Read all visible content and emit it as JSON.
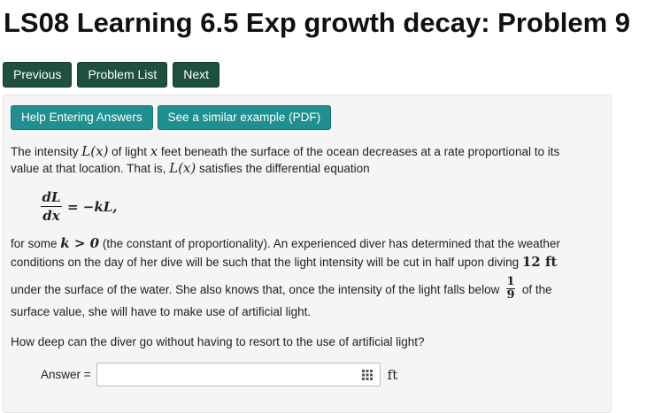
{
  "page": {
    "title": "LS08 Learning 6.5 Exp growth decay: Problem 9"
  },
  "nav": {
    "previous_label": "Previous",
    "problem_list_label": "Problem List",
    "next_label": "Next"
  },
  "help": {
    "help_entering_label": "Help Entering Answers",
    "similar_example_label": "See a similar example (PDF)"
  },
  "problem": {
    "p1_a": "The intensity ",
    "p1_Lx": "L(x)",
    "p1_b": " of light ",
    "p1_x": "x",
    "p1_c": " feet beneath the surface of the ocean decreases at a rate proportional to its",
    "p2_a": "value at that location. That is, ",
    "p2_Lx": "L(x)",
    "p2_b": " satisfies the differential equation",
    "eq_num": "dL",
    "eq_den": "dx",
    "eq_rhs": "= −kL,",
    "p3_a": "for some ",
    "p3_k": "k > 0",
    "p3_b": " (the constant of proportionality). An experienced diver has determined that the weather",
    "p4_a": "conditions on the day of her dive will be such that the light intensity will be cut in half upon diving ",
    "p4_depth": "12 ft",
    "p5_a": "under the surface of the water. She also knows that, once the intensity of the light falls below ",
    "p5_frac_num": "1",
    "p5_frac_den": "9",
    "p5_b": " of the",
    "p6": "surface value, she will have to make use of artificial light.",
    "question": "How deep can the diver go without having to resort to the use of artificial light?"
  },
  "answer": {
    "label": "Answer =",
    "value": "",
    "unit": "ft",
    "icon": "grid-icon"
  }
}
